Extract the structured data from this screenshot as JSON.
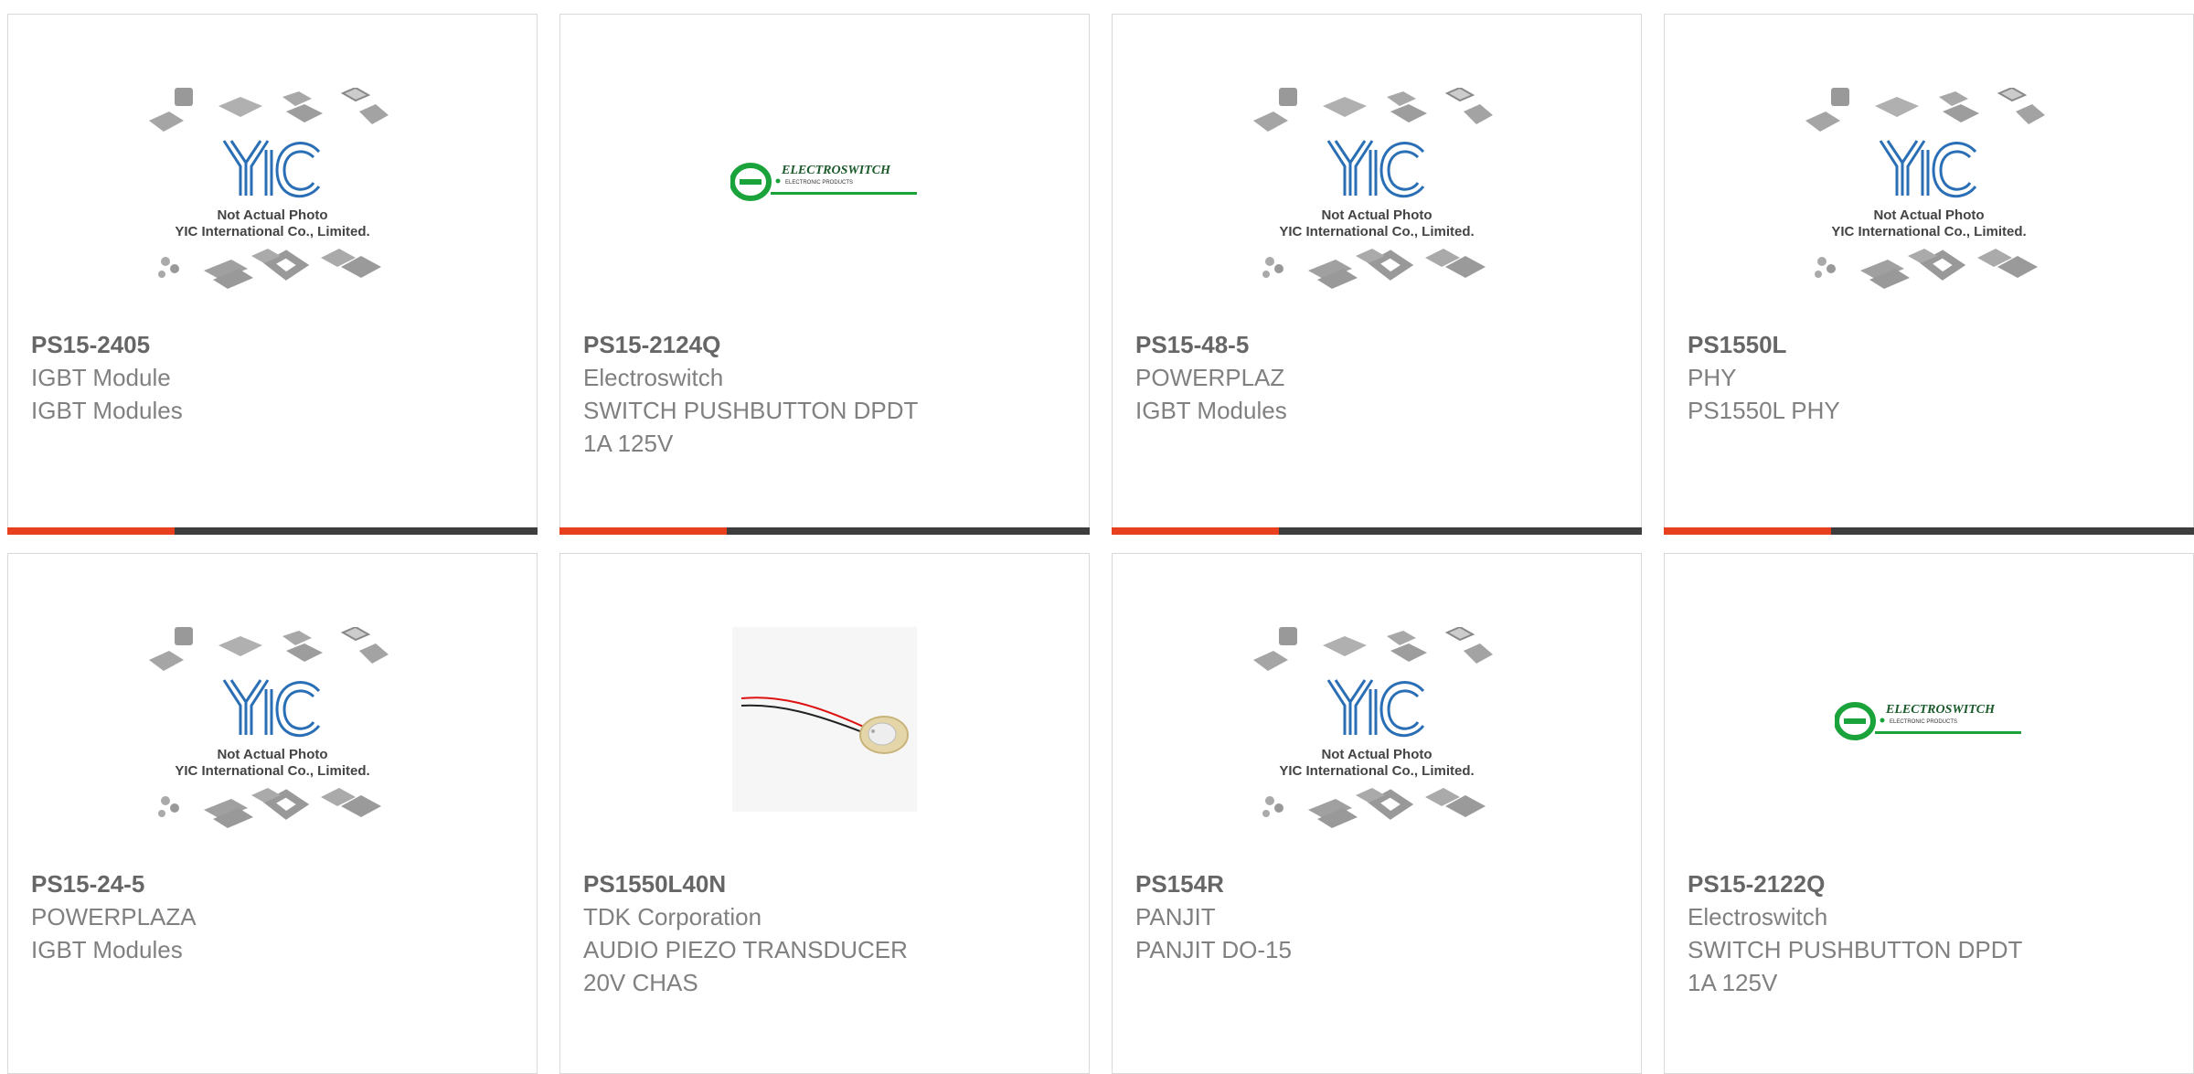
{
  "placeholder": {
    "line1": "Not Actual Photo",
    "line2": "YIC International Co., Limited."
  },
  "electroswitch_logo": {
    "brand": "ELECTROSWITCH",
    "tagline": "ELECTRONIC PRODUCTS",
    "color": "#1aa33a"
  },
  "accent_color": "#e8401c",
  "bar_color": "#3d3d3d",
  "products": [
    {
      "part": "PS15-2405",
      "maker": "IGBT Module",
      "desc": "IGBT Modules",
      "image": "yic-placeholder"
    },
    {
      "part": "PS15-2124Q",
      "maker": "Electroswitch",
      "desc": "SWITCH PUSHBUTTON DPDT\n1A 125V",
      "image": "electroswitch-logo"
    },
    {
      "part": "PS15-48-5",
      "maker": "POWERPLAZ",
      "desc": "IGBT Modules",
      "image": "yic-placeholder"
    },
    {
      "part": "PS1550L",
      "maker": "PHY",
      "desc": "PS1550L PHY",
      "image": "yic-placeholder"
    },
    {
      "part": "PS15-24-5",
      "maker": "POWERPLAZA",
      "desc": "IGBT Modules",
      "image": "yic-placeholder"
    },
    {
      "part": "PS1550L40N",
      "maker": "TDK Corporation",
      "desc": "AUDIO PIEZO TRANSDUCER\n20V CHAS",
      "image": "piezo-photo"
    },
    {
      "part": "PS154R",
      "maker": "PANJIT",
      "desc": "PANJIT DO-15",
      "image": "yic-placeholder"
    },
    {
      "part": "PS15-2122Q",
      "maker": "Electroswitch",
      "desc": "SWITCH PUSHBUTTON DPDT\n1A 125V",
      "image": "electroswitch-logo"
    }
  ]
}
